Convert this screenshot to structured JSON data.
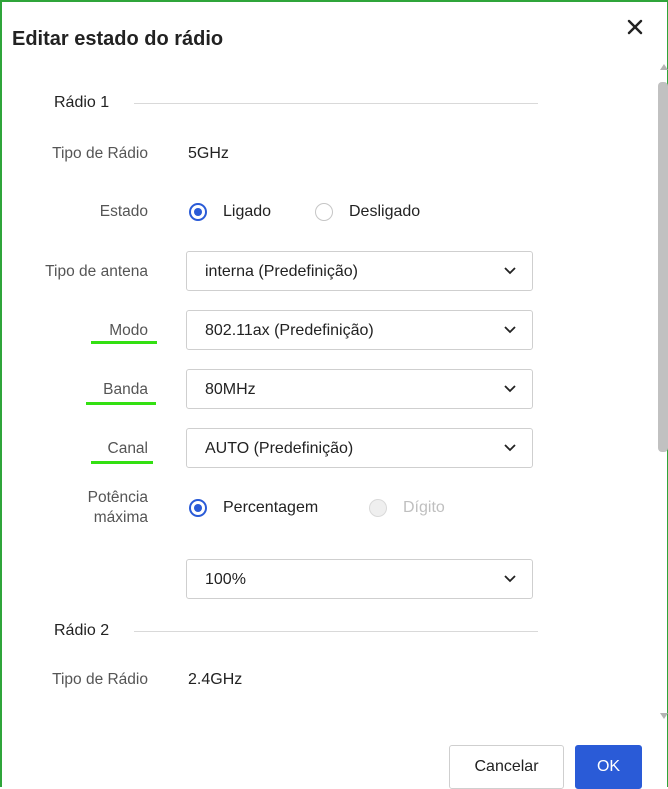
{
  "dialog": {
    "title": "Editar estado do rádio",
    "close_icon": "close-icon"
  },
  "radio1": {
    "section_title": "Rádio 1",
    "radio_type_label": "Tipo de Rádio",
    "radio_type_value": "5GHz",
    "state_label": "Estado",
    "state_on": "Ligado",
    "state_off": "Desligado",
    "antenna_label": "Tipo de antena",
    "antenna_value": "interna (Predefinição)",
    "mode_label": "Modo",
    "mode_value": "802.11ax (Predefinição)",
    "band_label": "Banda",
    "band_value": "80MHz",
    "channel_label": "Canal",
    "channel_value": "AUTO (Predefinição)",
    "power_label_1": "Potência",
    "power_label_2": "máxima",
    "power_percent": "Percentagem",
    "power_digit": "Dígito",
    "power_value": "100%"
  },
  "radio2": {
    "section_title": "Rádio 2",
    "radio_type_label": "Tipo de Rádio",
    "radio_type_value": "2.4GHz"
  },
  "footer": {
    "cancel_label": "Cancelar",
    "ok_label": "OK"
  },
  "colors": {
    "accent": "#2a5bd7",
    "highlight": "#33e012",
    "frame": "#2fa53a"
  }
}
